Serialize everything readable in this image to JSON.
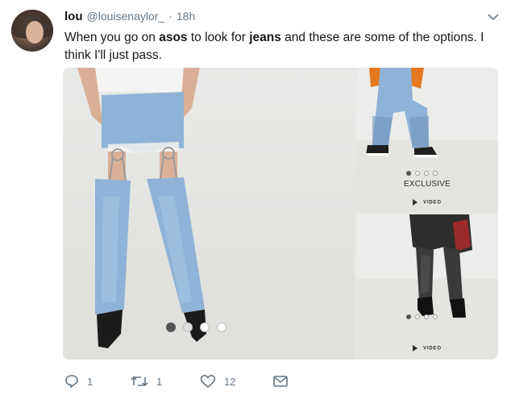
{
  "tweet": {
    "display_name": "lou",
    "handle": "@louisenaylor_",
    "separator": "·",
    "timestamp": "18h",
    "text": {
      "part1": "When you go on ",
      "bold1": "asos",
      "part2": " to look for ",
      "bold2": "jeans",
      "part3": " and these are some of the options. I think I'll just pass."
    }
  },
  "media": {
    "main_carousel": {
      "dot_count": 4,
      "active_index": 0
    },
    "top_tile": {
      "badge": "EXCLUSIVE",
      "video_label": "VIDEO",
      "dot_count": 4,
      "active_index": 0
    },
    "bottom_tile": {
      "video_label": "VIDEO",
      "dot_count": 4,
      "active_index": 0
    }
  },
  "actions": {
    "reply_count": "1",
    "retweet_count": "1",
    "like_count": "12",
    "icons": [
      "reply-icon",
      "retweet-icon",
      "like-icon",
      "direct-message-icon"
    ]
  },
  "colors": {
    "text": "#14171a",
    "secondary": "#657786",
    "denim": "#8fb3d6",
    "denim_dark": "#6f94bd",
    "black_jeans": "#3a3a3a"
  }
}
